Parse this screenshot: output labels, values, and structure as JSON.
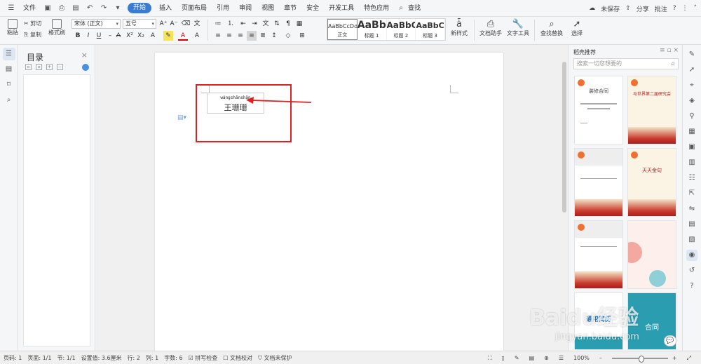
{
  "menubar": {
    "file": "文件",
    "tabs": [
      "开始",
      "插入",
      "页面布局",
      "引用",
      "审阅",
      "视图",
      "章节",
      "安全",
      "开发工具",
      "特色应用"
    ],
    "search": "查找",
    "unsaved": "未保存",
    "share": "分享",
    "annotate": "批注",
    "help": "?"
  },
  "ribbon": {
    "paste": "粘贴",
    "cut": "剪切",
    "copy": "复制",
    "format_painter": "格式刷",
    "font_name": "宋体 (正文)",
    "font_size": "五号",
    "styles": [
      {
        "sample": "AaBbCcDd",
        "name": "正文"
      },
      {
        "sample": "AaBb",
        "name": "标题 1"
      },
      {
        "sample": "AaBbC",
        "name": "标题 2"
      },
      {
        "sample": "AaBbC",
        "name": "标题 3"
      }
    ],
    "new_style": "新样式",
    "doc_helper": "文档助手",
    "text_tools": "文字工具",
    "find_replace": "查找替换",
    "select": "选择"
  },
  "toc": {
    "title": "目录"
  },
  "document": {
    "pinyin": "wángshānshān",
    "hanzi": "王珊珊"
  },
  "template_pane": {
    "title": "稻壳推荐",
    "search_placeholder": "搜索一切您想要的",
    "cards": [
      {
        "title": "装修合同"
      },
      {
        "title": "与世界第二届研究会"
      },
      {
        "title": ""
      },
      {
        "title": "天天金句"
      },
      {
        "title": ""
      },
      {
        "title": ""
      },
      {
        "title": "通用简历"
      },
      {
        "title": "合同"
      }
    ]
  },
  "status": {
    "page_num": "页码: 1",
    "pages": "页面: 1/1",
    "section": "节: 1/1",
    "setting": "设置值: 3.6厘米",
    "row": "行: 2",
    "col": "列: 1",
    "words": "字数: 6",
    "spell": "拼写检查",
    "proof": "文档校对",
    "protect": "文档未保护",
    "zoom": "100%"
  },
  "watermark": {
    "main": "Baidu经验",
    "sub": "jingyan.baidu.com"
  }
}
